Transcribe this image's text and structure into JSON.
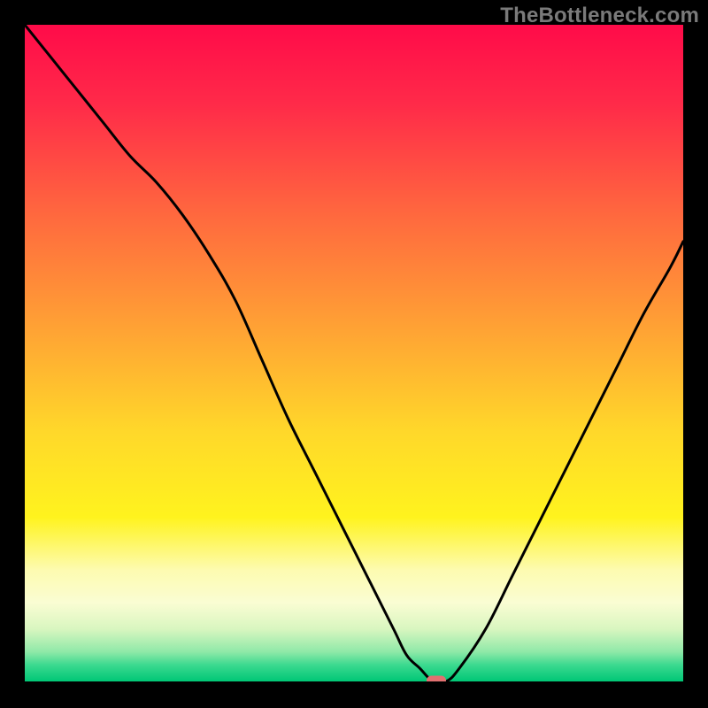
{
  "watermark": "TheBottleneck.com",
  "chart_data": {
    "type": "line",
    "title": "",
    "xlabel": "",
    "ylabel": "",
    "xlim": [
      0,
      100
    ],
    "ylim": [
      0,
      100
    ],
    "grid": false,
    "legend": false,
    "background": {
      "type": "vertical-gradient",
      "stops": [
        {
          "pos": 0.0,
          "color": "#ff0b49"
        },
        {
          "pos": 0.12,
          "color": "#ff2a49"
        },
        {
          "pos": 0.28,
          "color": "#ff653f"
        },
        {
          "pos": 0.45,
          "color": "#ff9e35"
        },
        {
          "pos": 0.62,
          "color": "#ffd82a"
        },
        {
          "pos": 0.75,
          "color": "#fff31e"
        },
        {
          "pos": 0.83,
          "color": "#fdfbb0"
        },
        {
          "pos": 0.88,
          "color": "#fafdd3"
        },
        {
          "pos": 0.92,
          "color": "#d9f6c0"
        },
        {
          "pos": 0.955,
          "color": "#8fe9a8"
        },
        {
          "pos": 0.975,
          "color": "#3bd98f"
        },
        {
          "pos": 1.0,
          "color": "#00c776"
        }
      ]
    },
    "optimum_marker": {
      "x": 62.5,
      "y": 0,
      "color": "#e17070",
      "shape": "pill"
    },
    "series": [
      {
        "name": "bottleneck-curve",
        "color": "#000000",
        "x": [
          0,
          4,
          8,
          12,
          16,
          20,
          24,
          28,
          32,
          36,
          40,
          44,
          48,
          52,
          56,
          58,
          60,
          62,
          64,
          66,
          70,
          74,
          78,
          82,
          86,
          90,
          94,
          98,
          100
        ],
        "y": [
          100,
          95,
          90,
          85,
          80,
          76,
          71,
          65,
          58,
          49,
          40,
          32,
          24,
          16,
          8,
          4,
          2,
          0,
          0,
          2,
          8,
          16,
          24,
          32,
          40,
          48,
          56,
          63,
          67
        ]
      }
    ]
  }
}
